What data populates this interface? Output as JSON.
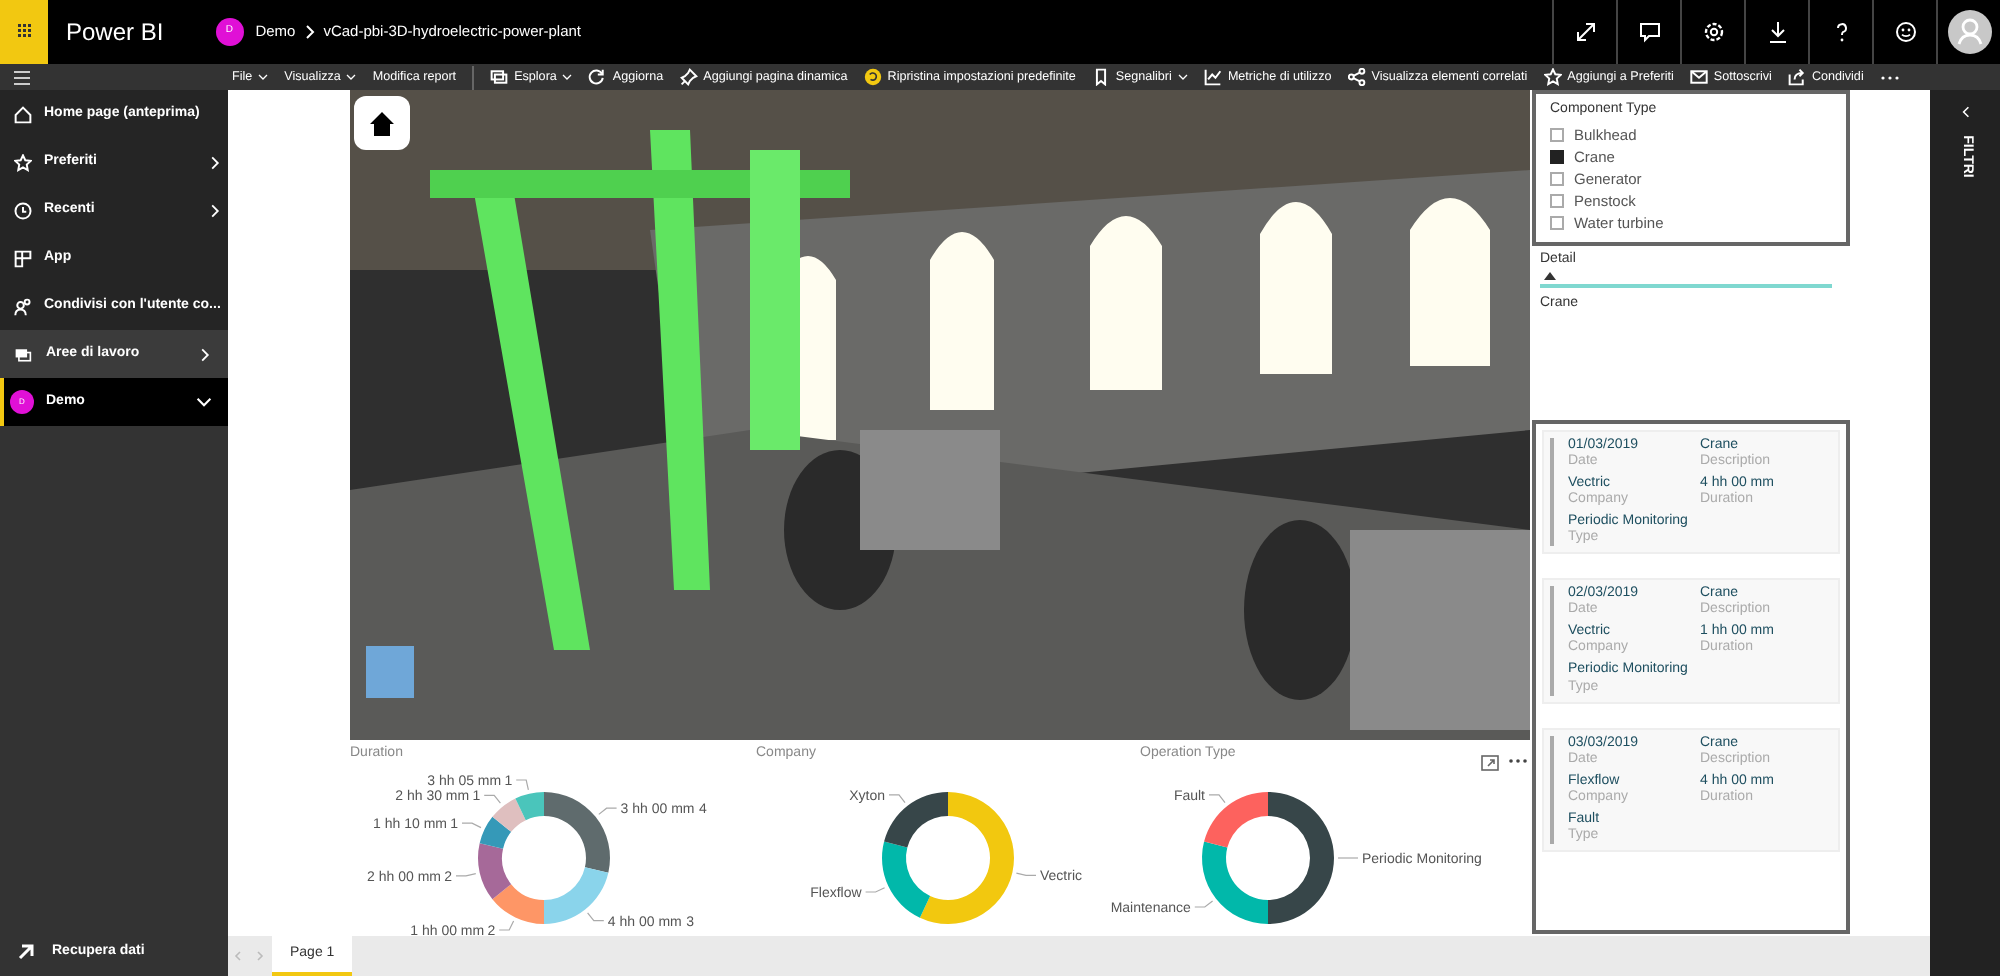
{
  "app_bar": {
    "app_name": "Power BI",
    "workspace_avatar": "D",
    "breadcrumb": [
      "Demo",
      "vCad-pbi-3D-hydroelectric-power-plant"
    ]
  },
  "toolbar": [
    {
      "label": "File",
      "kind": "menu"
    },
    {
      "label": "Visualizza",
      "kind": "menu"
    },
    {
      "label": "Modifica report",
      "kind": "plain"
    },
    {
      "label": "Esplora",
      "kind": "menu"
    },
    {
      "label": "Aggiorna",
      "kind": "plain"
    },
    {
      "label": "Aggiungi pagina dinamica",
      "kind": "plain"
    },
    {
      "label": "Ripristina impostazioni predefinite",
      "kind": "plain"
    },
    {
      "label": "Segnalibri",
      "kind": "menu"
    },
    {
      "label": "Metriche di utilizzo",
      "kind": "plain"
    },
    {
      "label": "Visualizza elementi correlati",
      "kind": "plain"
    },
    {
      "label": "Aggiungi a Preferiti",
      "kind": "plain"
    },
    {
      "label": "Sottoscrivi",
      "kind": "plain"
    },
    {
      "label": "Condividi",
      "kind": "plain"
    }
  ],
  "sidebar": {
    "items": [
      {
        "label": "Home page (anteprima)",
        "chevron": false
      },
      {
        "label": "Preferiti",
        "chevron": true
      },
      {
        "label": "Recenti",
        "chevron": true
      },
      {
        "label": "App",
        "chevron": false
      },
      {
        "label": "Condivisi con l'utente co...",
        "chevron": false
      }
    ],
    "workspaces": {
      "label": "Aree di lavoro"
    },
    "current_workspace": {
      "avatar": "D",
      "label": "Demo",
      "expanded": true,
      "selected": true
    },
    "bottom": {
      "label": "Recupera dati"
    }
  },
  "slicer": {
    "title": "Component Type",
    "options": [
      {
        "label": "Bulkhead",
        "checked": false
      },
      {
        "label": "Crane",
        "checked": true
      },
      {
        "label": "Generator",
        "checked": false
      },
      {
        "label": "Penstock",
        "checked": false
      },
      {
        "label": "Water turbine",
        "checked": false
      }
    ]
  },
  "detail_table": {
    "column": "Detail",
    "rows": [
      "Crane"
    ]
  },
  "cards": [
    {
      "date": "01/03/2019",
      "date_label": "Date",
      "description": "Crane",
      "description_label": "Description",
      "company": "Vectric",
      "company_label": "Company",
      "duration": "4 hh 00 mm",
      "duration_label": "Duration",
      "type": "Periodic Monitoring",
      "type_label": "Type"
    },
    {
      "date": "02/03/2019",
      "date_label": "Date",
      "description": "Crane",
      "description_label": "Description",
      "company": "Vectric",
      "company_label": "Company",
      "duration": "1 hh 00 mm",
      "duration_label": "Duration",
      "type": "Periodic Monitoring",
      "type_label": "Type"
    },
    {
      "date": "03/03/2019",
      "date_label": "Date",
      "description": "Crane",
      "description_label": "Description",
      "company": "Flexflow",
      "company_label": "Company",
      "duration": "4 hh 00 mm",
      "duration_label": "Duration",
      "type": "Fault",
      "type_label": "Type"
    }
  ],
  "charts": [
    {
      "chart_data": {
        "type": "donut",
        "title": "Duration",
        "categories": [
          "3 hh 00 mm",
          "4 hh 00 mm",
          "1 hh 00 mm",
          "2 hh 00 mm",
          "1 hh 10 mm",
          "2 hh 30 mm",
          "3 hh 05 mm"
        ],
        "series": [
          {
            "values": [
              4,
              3,
              2,
              2,
              1,
              1,
              1
            ]
          }
        ],
        "colors": [
          "#5f6b6d",
          "#8ad4eb",
          "#fe9666",
          "#a66999",
          "#3599b8",
          "#dfbfbf",
          "#4ac5bb"
        ],
        "data_labels": true
      }
    },
    {
      "chart_data": {
        "type": "donut",
        "title": "Company",
        "categories": [
          "Vectric",
          "Flexflow",
          "Xyton"
        ],
        "series": [
          {
            "values": [
              57,
              22,
              21
            ]
          }
        ],
        "colors": [
          "#f2c80f",
          "#01b8aa",
          "#374649"
        ]
      }
    },
    {
      "chart_data": {
        "type": "donut",
        "title": "Operation Type",
        "categories": [
          "Periodic Monitoring",
          "Maintenance",
          "Fault"
        ],
        "series": [
          {
            "values": [
              50,
              29,
              21
            ]
          }
        ],
        "colors": [
          "#374649",
          "#01b8aa",
          "#fd625e"
        ]
      }
    }
  ],
  "page_tabs": [
    {
      "label": "Page 1",
      "selected": true
    }
  ],
  "filters_pane": {
    "label": "FILTRI"
  }
}
